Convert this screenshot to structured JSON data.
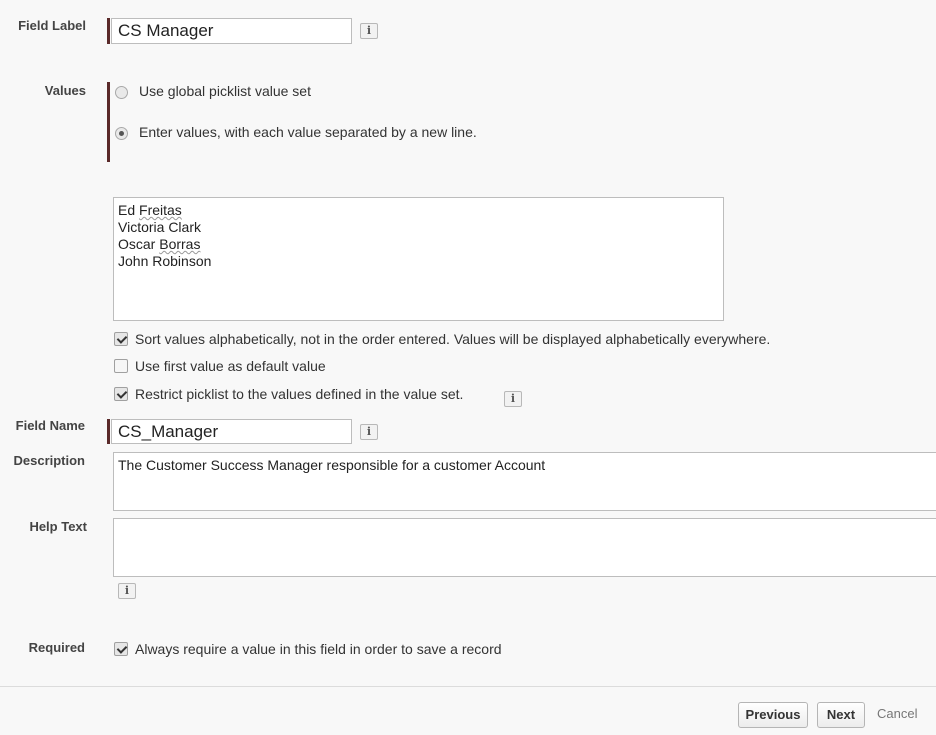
{
  "field_label": {
    "label": "Field Label",
    "value": "CS Manager",
    "info_icon": "info-icon"
  },
  "values": {
    "label": "Values",
    "options": [
      {
        "text": "Use global picklist value set",
        "selected": false
      },
      {
        "text": "Enter values, with each value separated by a new line.",
        "selected": true
      }
    ],
    "entries": [
      "Ed Freitas",
      "Victoria Clark",
      "Oscar Borras",
      "John Robinson"
    ]
  },
  "checkboxes": [
    {
      "text": "Sort values alphabetically, not in the order entered. Values will be displayed alphabetically everywhere.",
      "checked": true
    },
    {
      "text": "Use first value as default value",
      "checked": false
    },
    {
      "text": "Restrict picklist to the values defined in the value set.",
      "checked": true
    }
  ],
  "field_name": {
    "label": "Field Name",
    "value": "CS_Manager"
  },
  "description": {
    "label": "Description",
    "value": "The Customer Success Manager responsible for a customer Account"
  },
  "help_text": {
    "label": "Help Text",
    "value": ""
  },
  "required": {
    "label": "Required",
    "text": "Always require a value in this field in order to save a record",
    "checked": true
  },
  "footer": {
    "previous_label": "Previous",
    "next_label": "Next",
    "cancel_label": "Cancel"
  },
  "info_glyph": "i"
}
